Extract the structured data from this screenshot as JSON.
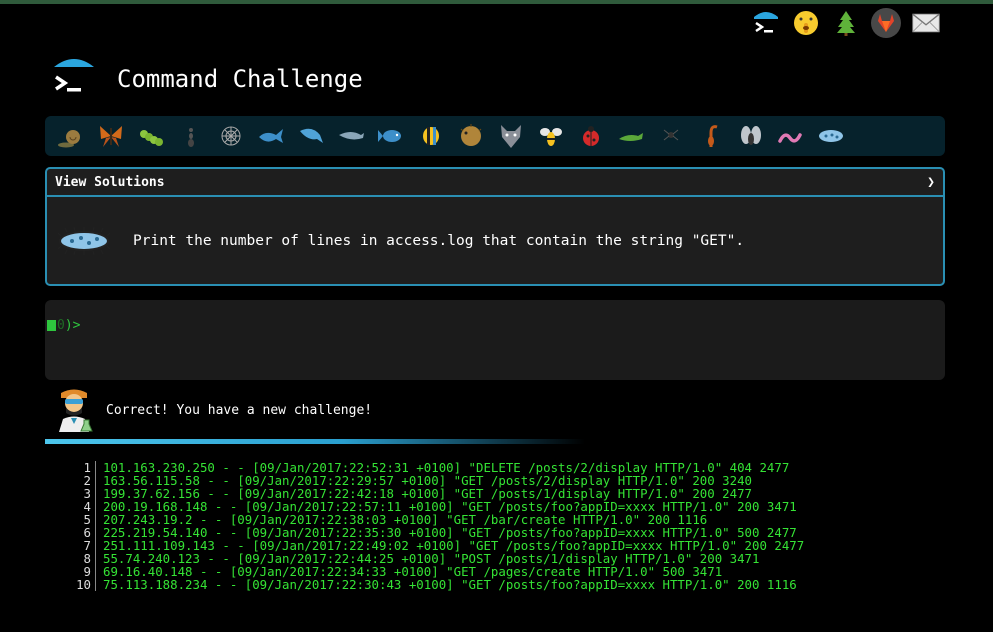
{
  "app": {
    "title": "Command Challenge"
  },
  "top_nav": [
    {
      "name": "terminal-logo-icon"
    },
    {
      "name": "shush-face-icon"
    },
    {
      "name": "tree-icon"
    },
    {
      "name": "gitlab-icon"
    },
    {
      "name": "mail-icon"
    }
  ],
  "emoji_bar": {
    "icons": [
      "snail",
      "butterfly",
      "caterpillar",
      "ant",
      "spider-web",
      "whale",
      "dolphin",
      "dolphin",
      "fish",
      "tropical-fish",
      "blowfish",
      "wolf",
      "bee",
      "ladybug",
      "lizard",
      "spider",
      "scorpion",
      "fly",
      "worm",
      "microbe"
    ]
  },
  "challenge": {
    "header": "View Solutions",
    "chevron": "❯",
    "text": "Print the number of lines in access.log that contain the string \"GET\"."
  },
  "terminal": {
    "prompt_num": "0",
    "prompt_suffix": ")>"
  },
  "feedback": {
    "message": "Correct! You have a new challenge!"
  },
  "log": {
    "lines": [
      {
        "num": "1",
        "text": "101.163.230.250 - - [09/Jan/2017:22:52:31 +0100] \"DELETE /posts/2/display HTTP/1.0\" 404 2477"
      },
      {
        "num": "2",
        "text": "163.56.115.58 - - [09/Jan/2017:22:29:57 +0100] \"GET /posts/2/display HTTP/1.0\" 200 3240"
      },
      {
        "num": "3",
        "text": "199.37.62.156 - - [09/Jan/2017:22:42:18 +0100] \"GET /posts/1/display HTTP/1.0\" 200 2477"
      },
      {
        "num": "4",
        "text": "200.19.168.148 - - [09/Jan/2017:22:57:11 +0100] \"GET /posts/foo?appID=xxxx HTTP/1.0\" 200 3471"
      },
      {
        "num": "5",
        "text": "207.243.19.2 - - [09/Jan/2017:22:38:03 +0100] \"GET /bar/create HTTP/1.0\" 200 1116"
      },
      {
        "num": "6",
        "text": "225.219.54.140 - - [09/Jan/2017:22:35:30 +0100] \"GET /posts/foo?appID=xxxx HTTP/1.0\" 500 2477"
      },
      {
        "num": "7",
        "text": "251.111.109.143 - - [09/Jan/2017:22:49:02 +0100] \"GET /posts/foo?appID=xxxx HTTP/1.0\" 200 2477"
      },
      {
        "num": "8",
        "text": "55.74.240.123 - - [09/Jan/2017:22:44:25 +0100] \"POST /posts/1/display HTTP/1.0\" 200 3471"
      },
      {
        "num": "9",
        "text": "69.16.40.148 - - [09/Jan/2017:22:34:33 +0100] \"GET /pages/create HTTP/1.0\" 500 3471"
      },
      {
        "num": "10",
        "text": "75.113.188.234 - - [09/Jan/2017:22:30:43 +0100] \"GET /posts/foo?appID=xxxx HTTP/1.0\" 200 1116"
      }
    ]
  },
  "colors": {
    "accent": "#2a8fb3",
    "terminal_green": "#2ec63e",
    "log_green": "#35e335",
    "emoji_bar_bg": "#06222c"
  }
}
